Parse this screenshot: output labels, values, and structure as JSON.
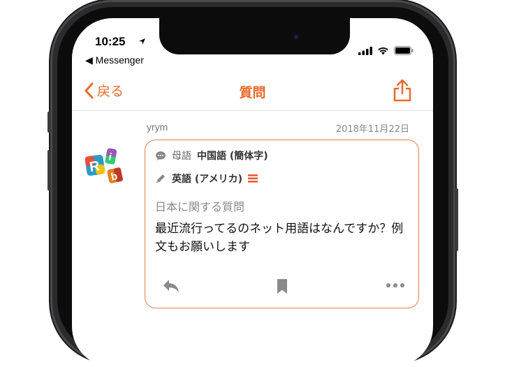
{
  "status_bar": {
    "time": "10:25",
    "back_app": "◀ Messenger"
  },
  "nav": {
    "back_label": "戻る",
    "title": "質問"
  },
  "post": {
    "username": "yrym",
    "date": "2018年11月22日",
    "native_label": "母語",
    "native_value": "中国語 (簡体字)",
    "target_language": "英語 (アメリカ)",
    "category": "日本に関する質問",
    "question": "最近流行ってるのネット用語はなんですか？例文もお願いします"
  },
  "colors": {
    "accent": "#ea6a2a",
    "border": "#ea7b48"
  },
  "icons": {
    "back": "chevron-left-icon",
    "share": "share-icon",
    "speech": "speech-bubble-icon",
    "pencil": "pencil-icon",
    "level": "level-bars-icon",
    "reply": "reply-icon",
    "bookmark": "bookmark-icon",
    "more": "more-icon"
  }
}
